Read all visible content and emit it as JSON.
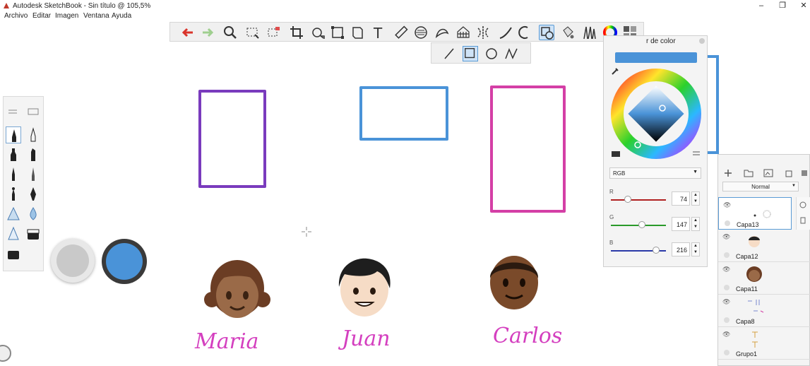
{
  "window": {
    "title": "Autodesk SketchBook - Sin título @ 105,5%"
  },
  "menu": {
    "items": [
      "Archivo",
      "Editar",
      "Imagen",
      "Ventana",
      "Ayuda"
    ]
  },
  "toolbar": {
    "tools": [
      "undo-icon",
      "redo-icon",
      "zoom-icon",
      "select-icon",
      "lasso-select-icon",
      "crop-icon",
      "transform-icon",
      "distort-icon",
      "perspective-icon",
      "text-icon",
      "ruler-icon",
      "ellipse-guide-icon",
      "french-curve-icon",
      "perspective-grid-icon",
      "symmetry-icon",
      "stroke-icon",
      "predictive-stroke-icon",
      "shape-icon",
      "fill-icon",
      "brush-library-icon",
      "color-wheel-icon",
      "copic-library-icon"
    ],
    "selected": "shape-icon"
  },
  "shapebar": {
    "tools": [
      "line-icon",
      "rectangle-icon",
      "ellipse-icon",
      "polyline-icon"
    ],
    "selected": "rectangle-icon"
  },
  "colorpanel": {
    "header": "r de color",
    "current_color": "#4a93d8",
    "mode": "RGB",
    "r": {
      "label": "R",
      "value": "74"
    },
    "g": {
      "label": "G",
      "value": "147"
    },
    "b": {
      "label": "B",
      "value": "216"
    }
  },
  "layerpanel": {
    "blend_mode": "Normal",
    "layers": [
      "Capa13",
      "Capa12",
      "Capa11",
      "Capa8",
      "Grupo1"
    ]
  },
  "canvas": {
    "names": [
      "Maria",
      "Juan",
      "Carlos"
    ],
    "colors": {
      "purple": "#7a3bbd",
      "blue": "#4a93d8",
      "magenta": "#d43fa6",
      "name_ink": "#d43fbf"
    }
  }
}
